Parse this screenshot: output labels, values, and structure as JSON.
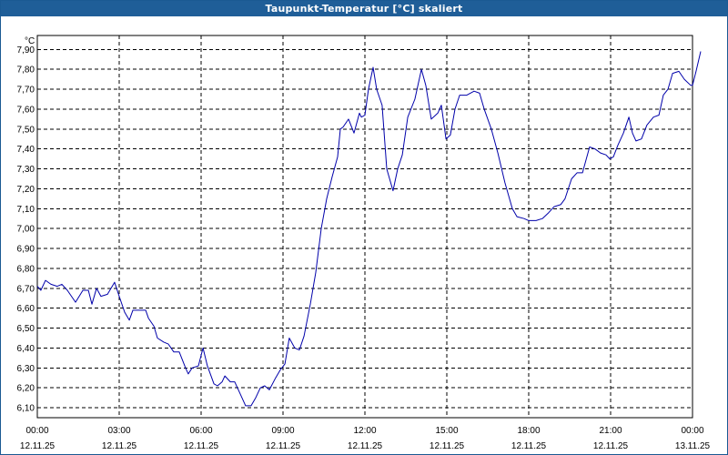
{
  "window": {
    "title": "Taupunkt-Temperatur [°C] skaliert"
  },
  "chart_data": {
    "type": "line",
    "title": "Taupunkt-Temperatur [°C] skaliert",
    "ylabel": "°C",
    "xlabel": "",
    "ylim": [
      6.05,
      7.97
    ],
    "xlim_hours": [
      0,
      24
    ],
    "grid": true,
    "grid_style": "dashed",
    "colors": {
      "series": "#0000aa",
      "grid": "#000000",
      "title_bar": "#1f5e98",
      "plot_bg": "#ffffff"
    },
    "y_ticks": [
      {
        "value": 6.1,
        "label": "6,10"
      },
      {
        "value": 6.2,
        "label": "6,20"
      },
      {
        "value": 6.3,
        "label": "6,30"
      },
      {
        "value": 6.4,
        "label": "6,40"
      },
      {
        "value": 6.5,
        "label": "6,50"
      },
      {
        "value": 6.6,
        "label": "6,60"
      },
      {
        "value": 6.7,
        "label": "6,70"
      },
      {
        "value": 6.8,
        "label": "6,80"
      },
      {
        "value": 6.9,
        "label": "6,90"
      },
      {
        "value": 7.0,
        "label": "7,00"
      },
      {
        "value": 7.1,
        "label": "7,10"
      },
      {
        "value": 7.2,
        "label": "7,20"
      },
      {
        "value": 7.3,
        "label": "7,30"
      },
      {
        "value": 7.4,
        "label": "7,40"
      },
      {
        "value": 7.5,
        "label": "7,50"
      },
      {
        "value": 7.6,
        "label": "7,60"
      },
      {
        "value": 7.7,
        "label": "7,70"
      },
      {
        "value": 7.8,
        "label": "7,80"
      },
      {
        "value": 7.9,
        "label": "7,90"
      }
    ],
    "x_ticks": [
      {
        "hour": 0,
        "time": "00:00",
        "date": "12.11.25"
      },
      {
        "hour": 3,
        "time": "03:00",
        "date": "12.11.25"
      },
      {
        "hour": 6,
        "time": "06:00",
        "date": "12.11.25"
      },
      {
        "hour": 9,
        "time": "09:00",
        "date": "12.11.25"
      },
      {
        "hour": 12,
        "time": "12:00",
        "date": "12.11.25"
      },
      {
        "hour": 15,
        "time": "15:00",
        "date": "12.11.25"
      },
      {
        "hour": 18,
        "time": "18:00",
        "date": "12.11.25"
      },
      {
        "hour": 21,
        "time": "21:00",
        "date": "12.11.25"
      },
      {
        "hour": 24,
        "time": "00:00",
        "date": "13.11.25"
      }
    ],
    "series": [
      {
        "points": [
          [
            0.0,
            6.71
          ],
          [
            0.13,
            6.69
          ],
          [
            0.3,
            6.74
          ],
          [
            0.5,
            6.72
          ],
          [
            0.73,
            6.71
          ],
          [
            0.9,
            6.72
          ],
          [
            1.1,
            6.69
          ],
          [
            1.4,
            6.63
          ],
          [
            1.67,
            6.69
          ],
          [
            1.87,
            6.69
          ],
          [
            2.0,
            6.62
          ],
          [
            2.17,
            6.7
          ],
          [
            2.33,
            6.66
          ],
          [
            2.57,
            6.67
          ],
          [
            2.83,
            6.73
          ],
          [
            3.0,
            6.66
          ],
          [
            3.2,
            6.58
          ],
          [
            3.37,
            6.54
          ],
          [
            3.5,
            6.59
          ],
          [
            3.7,
            6.59
          ],
          [
            3.97,
            6.59
          ],
          [
            4.07,
            6.55
          ],
          [
            4.27,
            6.51
          ],
          [
            4.4,
            6.45
          ],
          [
            4.63,
            6.43
          ],
          [
            4.8,
            6.42
          ],
          [
            5.0,
            6.38
          ],
          [
            5.2,
            6.38
          ],
          [
            5.43,
            6.3
          ],
          [
            5.53,
            6.27
          ],
          [
            5.67,
            6.3
          ],
          [
            5.9,
            6.31
          ],
          [
            6.07,
            6.4
          ],
          [
            6.23,
            6.31
          ],
          [
            6.47,
            6.22
          ],
          [
            6.6,
            6.21
          ],
          [
            6.77,
            6.23
          ],
          [
            6.87,
            6.26
          ],
          [
            7.07,
            6.23
          ],
          [
            7.23,
            6.23
          ],
          [
            7.43,
            6.17
          ],
          [
            7.63,
            6.11
          ],
          [
            7.83,
            6.11
          ],
          [
            8.0,
            6.15
          ],
          [
            8.17,
            6.2
          ],
          [
            8.33,
            6.21
          ],
          [
            8.5,
            6.19
          ],
          [
            8.73,
            6.25
          ],
          [
            8.9,
            6.29
          ],
          [
            9.07,
            6.32
          ],
          [
            9.23,
            6.45
          ],
          [
            9.43,
            6.4
          ],
          [
            9.6,
            6.39
          ],
          [
            9.77,
            6.46
          ],
          [
            10.0,
            6.62
          ],
          [
            10.2,
            6.78
          ],
          [
            10.4,
            7.0
          ],
          [
            10.6,
            7.15
          ],
          [
            10.8,
            7.26
          ],
          [
            11.0,
            7.36
          ],
          [
            11.1,
            7.5
          ],
          [
            11.2,
            7.51
          ],
          [
            11.4,
            7.55
          ],
          [
            11.6,
            7.48
          ],
          [
            11.8,
            7.58
          ],
          [
            11.87,
            7.56
          ],
          [
            12.0,
            7.57
          ],
          [
            12.13,
            7.7
          ],
          [
            12.3,
            7.81
          ],
          [
            12.43,
            7.7
          ],
          [
            12.63,
            7.62
          ],
          [
            12.8,
            7.3
          ],
          [
            13.03,
            7.19
          ],
          [
            13.2,
            7.3
          ],
          [
            13.37,
            7.37
          ],
          [
            13.57,
            7.56
          ],
          [
            13.83,
            7.65
          ],
          [
            14.07,
            7.8
          ],
          [
            14.23,
            7.72
          ],
          [
            14.43,
            7.55
          ],
          [
            14.67,
            7.58
          ],
          [
            14.8,
            7.62
          ],
          [
            14.97,
            7.45
          ],
          [
            15.13,
            7.47
          ],
          [
            15.3,
            7.6
          ],
          [
            15.47,
            7.67
          ],
          [
            15.73,
            7.67
          ],
          [
            16.0,
            7.69
          ],
          [
            16.2,
            7.68
          ],
          [
            16.37,
            7.6
          ],
          [
            16.63,
            7.5
          ],
          [
            16.87,
            7.38
          ],
          [
            17.13,
            7.23
          ],
          [
            17.4,
            7.1
          ],
          [
            17.57,
            7.06
          ],
          [
            17.83,
            7.05
          ],
          [
            18.0,
            7.04
          ],
          [
            18.27,
            7.04
          ],
          [
            18.5,
            7.05
          ],
          [
            18.73,
            7.08
          ],
          [
            18.93,
            7.11
          ],
          [
            19.17,
            7.12
          ],
          [
            19.33,
            7.15
          ],
          [
            19.57,
            7.25
          ],
          [
            19.77,
            7.28
          ],
          [
            19.97,
            7.28
          ],
          [
            20.23,
            7.41
          ],
          [
            20.43,
            7.4
          ],
          [
            20.63,
            7.38
          ],
          [
            20.83,
            7.37
          ],
          [
            20.97,
            7.35
          ],
          [
            21.1,
            7.36
          ],
          [
            21.27,
            7.42
          ],
          [
            21.47,
            7.48
          ],
          [
            21.67,
            7.56
          ],
          [
            21.8,
            7.48
          ],
          [
            21.93,
            7.44
          ],
          [
            22.13,
            7.45
          ],
          [
            22.33,
            7.52
          ],
          [
            22.57,
            7.56
          ],
          [
            22.77,
            7.57
          ],
          [
            22.93,
            7.67
          ],
          [
            23.1,
            7.7
          ],
          [
            23.27,
            7.78
          ],
          [
            23.5,
            7.79
          ],
          [
            23.7,
            7.75
          ],
          [
            23.93,
            7.72
          ],
          [
            24.0,
            7.72
          ],
          [
            24.13,
            7.79
          ],
          [
            24.3,
            7.89
          ]
        ]
      }
    ]
  }
}
